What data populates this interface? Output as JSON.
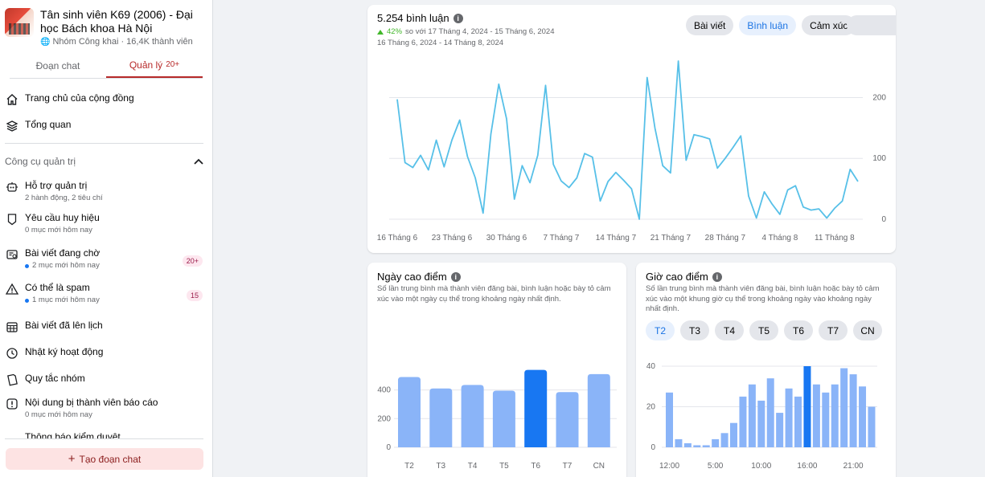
{
  "group": {
    "name": "Tân sinh viên K69 (2006) - Đại học Bách khoa Hà Nội",
    "meta": "Nhóm Công khai · 16,4K thành viên",
    "globe_icon": "globe-icon"
  },
  "tabs": [
    {
      "label": "Đoạn chat",
      "count": ""
    },
    {
      "label": "Quản lý",
      "count": "20+"
    }
  ],
  "nav": {
    "home": "Trang chủ của cộng đồng",
    "overview": "Tổng quan",
    "tools_title": "Công cụ quản trị",
    "items": [
      {
        "label": "Hỗ trợ quản trị",
        "sub": "2 hành động, 2 tiêu chí",
        "icon": "robot-icon"
      },
      {
        "label": "Yêu cầu huy hiệu",
        "sub": "0 mục mới hôm nay",
        "icon": "badge-icon"
      },
      {
        "label": "Bài viết đang chờ",
        "sub": "2 mục mới hôm nay",
        "badge": "20+",
        "icon": "pending-posts-icon"
      },
      {
        "label": "Có thể là spam",
        "sub": "1 mục mới hôm nay",
        "badge": "15",
        "icon": "warning-icon"
      },
      {
        "label": "Bài viết đã lên lịch",
        "sub": "",
        "icon": "calendar-icon"
      },
      {
        "label": "Nhật ký hoạt động",
        "sub": "",
        "icon": "clock-icon"
      },
      {
        "label": "Quy tắc nhóm",
        "sub": "",
        "icon": "rules-icon"
      },
      {
        "label": "Nội dung bị thành viên báo cáo",
        "sub": "0 mục mới hôm nay",
        "icon": "report-icon"
      },
      {
        "label": "Thông báo kiểm duyệt",
        "sub": "",
        "icon": "bell-icon"
      }
    ],
    "create_chat": "Tạo đoạn chat"
  },
  "comments": {
    "title": "5.254 bình luận",
    "change_pct": "42%",
    "change_text": "so với 17 Tháng 4, 2024 - 15 Tháng 6, 2024",
    "range": "16 Tháng 6, 2024 - 14 Tháng 8, 2024",
    "buttons": [
      "Bài viết",
      "Bình luận",
      "Cảm xúc"
    ],
    "positive_color": "#42b72a",
    "line_color": "#57c0e8"
  },
  "peak_day": {
    "title": "Ngày cao điểm",
    "desc": "Số lần trung bình mà thành viên đăng bài, bình luận hoặc bày tỏ cảm xúc vào một ngày cụ thể trong khoảng ngày nhất định."
  },
  "peak_hour": {
    "title": "Giờ cao điểm",
    "desc": "Số lần trung bình mà thành viên đăng bài, bình luận hoặc bày tỏ cảm xúc vào một khung giờ cụ thể trong khoảng ngày vào khoảng ngày nhất định.",
    "days": [
      "T2",
      "T3",
      "T4",
      "T5",
      "T6",
      "T7",
      "CN"
    ]
  },
  "chart_data": [
    {
      "type": "line",
      "title": "5.254 bình luận",
      "x_ticks": [
        "16 Tháng 6",
        "23 Tháng 6",
        "30 Tháng 6",
        "7 Tháng 7",
        "14 Tháng 7",
        "21 Tháng 7",
        "28 Tháng 7",
        "4 Tháng 8",
        "11 Tháng 8"
      ],
      "y_ticks": [
        0,
        100,
        200
      ],
      "ylim": [
        0,
        260
      ],
      "grid": true,
      "values": [
        197,
        93,
        85,
        105,
        81,
        130,
        86,
        130,
        163,
        103,
        68,
        10,
        140,
        222,
        165,
        33,
        88,
        60,
        105,
        220,
        90,
        63,
        52,
        68,
        108,
        102,
        30,
        62,
        77,
        64,
        50,
        0,
        233,
        150,
        88,
        76,
        260,
        97,
        139,
        136,
        132,
        84,
        100,
        118,
        137,
        38,
        2,
        45,
        25,
        8,
        48,
        55,
        20,
        15,
        17,
        2,
        18,
        30,
        82,
        62
      ]
    },
    {
      "type": "bar",
      "title": "Ngày cao điểm",
      "categories": [
        "T2",
        "T3",
        "T4",
        "T5",
        "T6",
        "T7",
        "CN"
      ],
      "values": [
        490,
        410,
        435,
        395,
        540,
        385,
        510
      ],
      "y_ticks": [
        0,
        200,
        400
      ],
      "ylim": [
        0,
        560
      ],
      "highlight": "T6",
      "bar_color": "#8ab4f8",
      "highlight_color": "#1877f2"
    },
    {
      "type": "bar",
      "title": "Giờ cao điểm",
      "selected_day": "T2",
      "x_ticks": [
        "12:00",
        "5:00",
        "10:00",
        "16:00",
        "21:00"
      ],
      "y_ticks": [
        0,
        20,
        40
      ],
      "ylim": [
        0,
        40
      ],
      "values": [
        27,
        4,
        2,
        1,
        1,
        4,
        7,
        12,
        25,
        31,
        23,
        34,
        17,
        29,
        25,
        40,
        31,
        27,
        31,
        39,
        36,
        30,
        20
      ],
      "highlight_index": 15,
      "bar_color": "#8ab4f8",
      "highlight_color": "#1877f2"
    }
  ]
}
